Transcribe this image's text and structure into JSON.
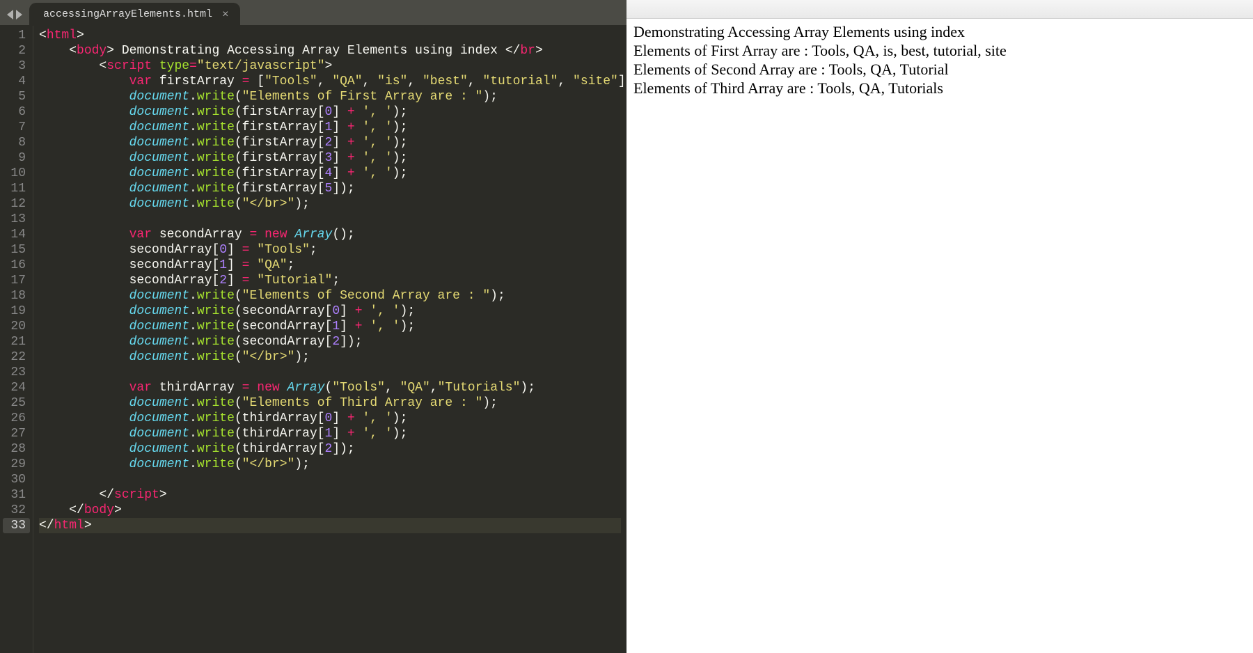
{
  "tab": {
    "filename": "accessingArrayElements.html",
    "close_label": "×"
  },
  "editor": {
    "line_count": 33,
    "current_line": 33,
    "lines": [
      {
        "n": 1,
        "indent": "",
        "tokens": [
          [
            "punc",
            "<"
          ],
          [
            "tag",
            "html"
          ],
          [
            "punc",
            ">"
          ]
        ]
      },
      {
        "n": 2,
        "indent": "    ",
        "tokens": [
          [
            "punc",
            "<"
          ],
          [
            "tag",
            "body"
          ],
          [
            "punc",
            ">"
          ],
          [
            "text",
            " Demonstrating Accessing Array Elements using index "
          ],
          [
            "punc",
            "</"
          ],
          [
            "tag",
            "br"
          ],
          [
            "punc",
            ">"
          ]
        ]
      },
      {
        "n": 3,
        "indent": "        ",
        "tokens": [
          [
            "punc",
            "<"
          ],
          [
            "tag",
            "script"
          ],
          [
            "text",
            " "
          ],
          [
            "attr",
            "type"
          ],
          [
            "op",
            "="
          ],
          [
            "str",
            "\"text/javascript\""
          ],
          [
            "punc",
            ">"
          ]
        ]
      },
      {
        "n": 4,
        "indent": "            ",
        "tokens": [
          [
            "tag",
            "var"
          ],
          [
            "text",
            " firstArray "
          ],
          [
            "op",
            "="
          ],
          [
            "text",
            " ["
          ],
          [
            "str",
            "\"Tools\""
          ],
          [
            "punc",
            ", "
          ],
          [
            "str",
            "\"QA\""
          ],
          [
            "punc",
            ", "
          ],
          [
            "str",
            "\"is\""
          ],
          [
            "punc",
            ", "
          ],
          [
            "str",
            "\"best\""
          ],
          [
            "punc",
            ", "
          ],
          [
            "str",
            "\"tutorial\""
          ],
          [
            "punc",
            ", "
          ],
          [
            "str",
            "\"site\""
          ],
          [
            "punc",
            "];"
          ]
        ]
      },
      {
        "n": 5,
        "indent": "            ",
        "tokens": [
          [
            "prop",
            "document"
          ],
          [
            "punc",
            "."
          ],
          [
            "attr",
            "write"
          ],
          [
            "punc",
            "("
          ],
          [
            "str",
            "\"Elements of First Array are : \""
          ],
          [
            "punc",
            ");"
          ]
        ]
      },
      {
        "n": 6,
        "indent": "            ",
        "tokens": [
          [
            "prop",
            "document"
          ],
          [
            "punc",
            "."
          ],
          [
            "attr",
            "write"
          ],
          [
            "punc",
            "(firstArray["
          ],
          [
            "num",
            "0"
          ],
          [
            "punc",
            "] "
          ],
          [
            "op",
            "+"
          ],
          [
            "text",
            " "
          ],
          [
            "str",
            "', '"
          ],
          [
            "punc",
            ");"
          ]
        ]
      },
      {
        "n": 7,
        "indent": "            ",
        "tokens": [
          [
            "prop",
            "document"
          ],
          [
            "punc",
            "."
          ],
          [
            "attr",
            "write"
          ],
          [
            "punc",
            "(firstArray["
          ],
          [
            "num",
            "1"
          ],
          [
            "punc",
            "] "
          ],
          [
            "op",
            "+"
          ],
          [
            "text",
            " "
          ],
          [
            "str",
            "', '"
          ],
          [
            "punc",
            ");"
          ]
        ]
      },
      {
        "n": 8,
        "indent": "            ",
        "tokens": [
          [
            "prop",
            "document"
          ],
          [
            "punc",
            "."
          ],
          [
            "attr",
            "write"
          ],
          [
            "punc",
            "(firstArray["
          ],
          [
            "num",
            "2"
          ],
          [
            "punc",
            "] "
          ],
          [
            "op",
            "+"
          ],
          [
            "text",
            " "
          ],
          [
            "str",
            "', '"
          ],
          [
            "punc",
            ");"
          ]
        ]
      },
      {
        "n": 9,
        "indent": "            ",
        "tokens": [
          [
            "prop",
            "document"
          ],
          [
            "punc",
            "."
          ],
          [
            "attr",
            "write"
          ],
          [
            "punc",
            "(firstArray["
          ],
          [
            "num",
            "3"
          ],
          [
            "punc",
            "] "
          ],
          [
            "op",
            "+"
          ],
          [
            "text",
            " "
          ],
          [
            "str",
            "', '"
          ],
          [
            "punc",
            ");"
          ]
        ]
      },
      {
        "n": 10,
        "indent": "            ",
        "tokens": [
          [
            "prop",
            "document"
          ],
          [
            "punc",
            "."
          ],
          [
            "attr",
            "write"
          ],
          [
            "punc",
            "(firstArray["
          ],
          [
            "num",
            "4"
          ],
          [
            "punc",
            "] "
          ],
          [
            "op",
            "+"
          ],
          [
            "text",
            " "
          ],
          [
            "str",
            "', '"
          ],
          [
            "punc",
            ");"
          ]
        ]
      },
      {
        "n": 11,
        "indent": "            ",
        "tokens": [
          [
            "prop",
            "document"
          ],
          [
            "punc",
            "."
          ],
          [
            "attr",
            "write"
          ],
          [
            "punc",
            "(firstArray["
          ],
          [
            "num",
            "5"
          ],
          [
            "punc",
            "]);"
          ]
        ]
      },
      {
        "n": 12,
        "indent": "            ",
        "tokens": [
          [
            "prop",
            "document"
          ],
          [
            "punc",
            "."
          ],
          [
            "attr",
            "write"
          ],
          [
            "punc",
            "("
          ],
          [
            "str",
            "\"</br>\""
          ],
          [
            "punc",
            ");"
          ]
        ]
      },
      {
        "n": 13,
        "indent": "",
        "tokens": []
      },
      {
        "n": 14,
        "indent": "            ",
        "tokens": [
          [
            "tag",
            "var"
          ],
          [
            "text",
            " secondArray "
          ],
          [
            "op",
            "="
          ],
          [
            "text",
            " "
          ],
          [
            "tag",
            "new"
          ],
          [
            "text",
            " "
          ],
          [
            "prop",
            "Array"
          ],
          [
            "punc",
            "();"
          ]
        ]
      },
      {
        "n": 15,
        "indent": "            ",
        "tokens": [
          [
            "text",
            "secondArray["
          ],
          [
            "num",
            "0"
          ],
          [
            "punc",
            "] "
          ],
          [
            "op",
            "="
          ],
          [
            "text",
            " "
          ],
          [
            "str",
            "\"Tools\""
          ],
          [
            "punc",
            ";"
          ]
        ]
      },
      {
        "n": 16,
        "indent": "            ",
        "tokens": [
          [
            "text",
            "secondArray["
          ],
          [
            "num",
            "1"
          ],
          [
            "punc",
            "] "
          ],
          [
            "op",
            "="
          ],
          [
            "text",
            " "
          ],
          [
            "str",
            "\"QA\""
          ],
          [
            "punc",
            ";"
          ]
        ]
      },
      {
        "n": 17,
        "indent": "            ",
        "tokens": [
          [
            "text",
            "secondArray["
          ],
          [
            "num",
            "2"
          ],
          [
            "punc",
            "] "
          ],
          [
            "op",
            "="
          ],
          [
            "text",
            " "
          ],
          [
            "str",
            "\"Tutorial\""
          ],
          [
            "punc",
            ";"
          ]
        ]
      },
      {
        "n": 18,
        "indent": "            ",
        "tokens": [
          [
            "prop",
            "document"
          ],
          [
            "punc",
            "."
          ],
          [
            "attr",
            "write"
          ],
          [
            "punc",
            "("
          ],
          [
            "str",
            "\"Elements of Second Array are : \""
          ],
          [
            "punc",
            ");"
          ]
        ]
      },
      {
        "n": 19,
        "indent": "            ",
        "tokens": [
          [
            "prop",
            "document"
          ],
          [
            "punc",
            "."
          ],
          [
            "attr",
            "write"
          ],
          [
            "punc",
            "(secondArray["
          ],
          [
            "num",
            "0"
          ],
          [
            "punc",
            "] "
          ],
          [
            "op",
            "+"
          ],
          [
            "text",
            " "
          ],
          [
            "str",
            "', '"
          ],
          [
            "punc",
            ");"
          ]
        ]
      },
      {
        "n": 20,
        "indent": "            ",
        "tokens": [
          [
            "prop",
            "document"
          ],
          [
            "punc",
            "."
          ],
          [
            "attr",
            "write"
          ],
          [
            "punc",
            "(secondArray["
          ],
          [
            "num",
            "1"
          ],
          [
            "punc",
            "] "
          ],
          [
            "op",
            "+"
          ],
          [
            "text",
            " "
          ],
          [
            "str",
            "', '"
          ],
          [
            "punc",
            ");"
          ]
        ]
      },
      {
        "n": 21,
        "indent": "            ",
        "tokens": [
          [
            "prop",
            "document"
          ],
          [
            "punc",
            "."
          ],
          [
            "attr",
            "write"
          ],
          [
            "punc",
            "(secondArray["
          ],
          [
            "num",
            "2"
          ],
          [
            "punc",
            "]);"
          ]
        ]
      },
      {
        "n": 22,
        "indent": "            ",
        "tokens": [
          [
            "prop",
            "document"
          ],
          [
            "punc",
            "."
          ],
          [
            "attr",
            "write"
          ],
          [
            "punc",
            "("
          ],
          [
            "str",
            "\"</br>\""
          ],
          [
            "punc",
            ");"
          ]
        ]
      },
      {
        "n": 23,
        "indent": "",
        "tokens": []
      },
      {
        "n": 24,
        "indent": "            ",
        "tokens": [
          [
            "tag",
            "var"
          ],
          [
            "text",
            " thirdArray "
          ],
          [
            "op",
            "="
          ],
          [
            "text",
            " "
          ],
          [
            "tag",
            "new"
          ],
          [
            "text",
            " "
          ],
          [
            "prop",
            "Array"
          ],
          [
            "punc",
            "("
          ],
          [
            "str",
            "\"Tools\""
          ],
          [
            "punc",
            ", "
          ],
          [
            "str",
            "\"QA\""
          ],
          [
            "punc",
            ","
          ],
          [
            "str",
            "\"Tutorials\""
          ],
          [
            "punc",
            ");"
          ]
        ]
      },
      {
        "n": 25,
        "indent": "            ",
        "tokens": [
          [
            "prop",
            "document"
          ],
          [
            "punc",
            "."
          ],
          [
            "attr",
            "write"
          ],
          [
            "punc",
            "("
          ],
          [
            "str",
            "\"Elements of Third Array are : \""
          ],
          [
            "punc",
            ");"
          ]
        ]
      },
      {
        "n": 26,
        "indent": "            ",
        "tokens": [
          [
            "prop",
            "document"
          ],
          [
            "punc",
            "."
          ],
          [
            "attr",
            "write"
          ],
          [
            "punc",
            "(thirdArray["
          ],
          [
            "num",
            "0"
          ],
          [
            "punc",
            "] "
          ],
          [
            "op",
            "+"
          ],
          [
            "text",
            " "
          ],
          [
            "str",
            "', '"
          ],
          [
            "punc",
            ");"
          ]
        ]
      },
      {
        "n": 27,
        "indent": "            ",
        "tokens": [
          [
            "prop",
            "document"
          ],
          [
            "punc",
            "."
          ],
          [
            "attr",
            "write"
          ],
          [
            "punc",
            "(thirdArray["
          ],
          [
            "num",
            "1"
          ],
          [
            "punc",
            "] "
          ],
          [
            "op",
            "+"
          ],
          [
            "text",
            " "
          ],
          [
            "str",
            "', '"
          ],
          [
            "punc",
            ");"
          ]
        ]
      },
      {
        "n": 28,
        "indent": "            ",
        "tokens": [
          [
            "prop",
            "document"
          ],
          [
            "punc",
            "."
          ],
          [
            "attr",
            "write"
          ],
          [
            "punc",
            "(thirdArray["
          ],
          [
            "num",
            "2"
          ],
          [
            "punc",
            "]);"
          ]
        ]
      },
      {
        "n": 29,
        "indent": "            ",
        "tokens": [
          [
            "prop",
            "document"
          ],
          [
            "punc",
            "."
          ],
          [
            "attr",
            "write"
          ],
          [
            "punc",
            "("
          ],
          [
            "str",
            "\"</br>\""
          ],
          [
            "punc",
            ");"
          ]
        ]
      },
      {
        "n": 30,
        "indent": "",
        "tokens": []
      },
      {
        "n": 31,
        "indent": "        ",
        "tokens": [
          [
            "punc",
            "</"
          ],
          [
            "tag",
            "script"
          ],
          [
            "punc",
            ">"
          ]
        ]
      },
      {
        "n": 32,
        "indent": "    ",
        "tokens": [
          [
            "punc",
            "</"
          ],
          [
            "tag",
            "body"
          ],
          [
            "punc",
            ">"
          ]
        ]
      },
      {
        "n": 33,
        "indent": "",
        "tokens": [
          [
            "punc",
            "</"
          ],
          [
            "tag",
            "html"
          ],
          [
            "punc",
            ">"
          ]
        ]
      }
    ]
  },
  "browser": {
    "lines": [
      "Demonstrating Accessing Array Elements using index",
      "Elements of First Array are : Tools, QA, is, best, tutorial, site",
      "Elements of Second Array are : Tools, QA, Tutorial",
      "Elements of Third Array are : Tools, QA, Tutorials"
    ]
  }
}
